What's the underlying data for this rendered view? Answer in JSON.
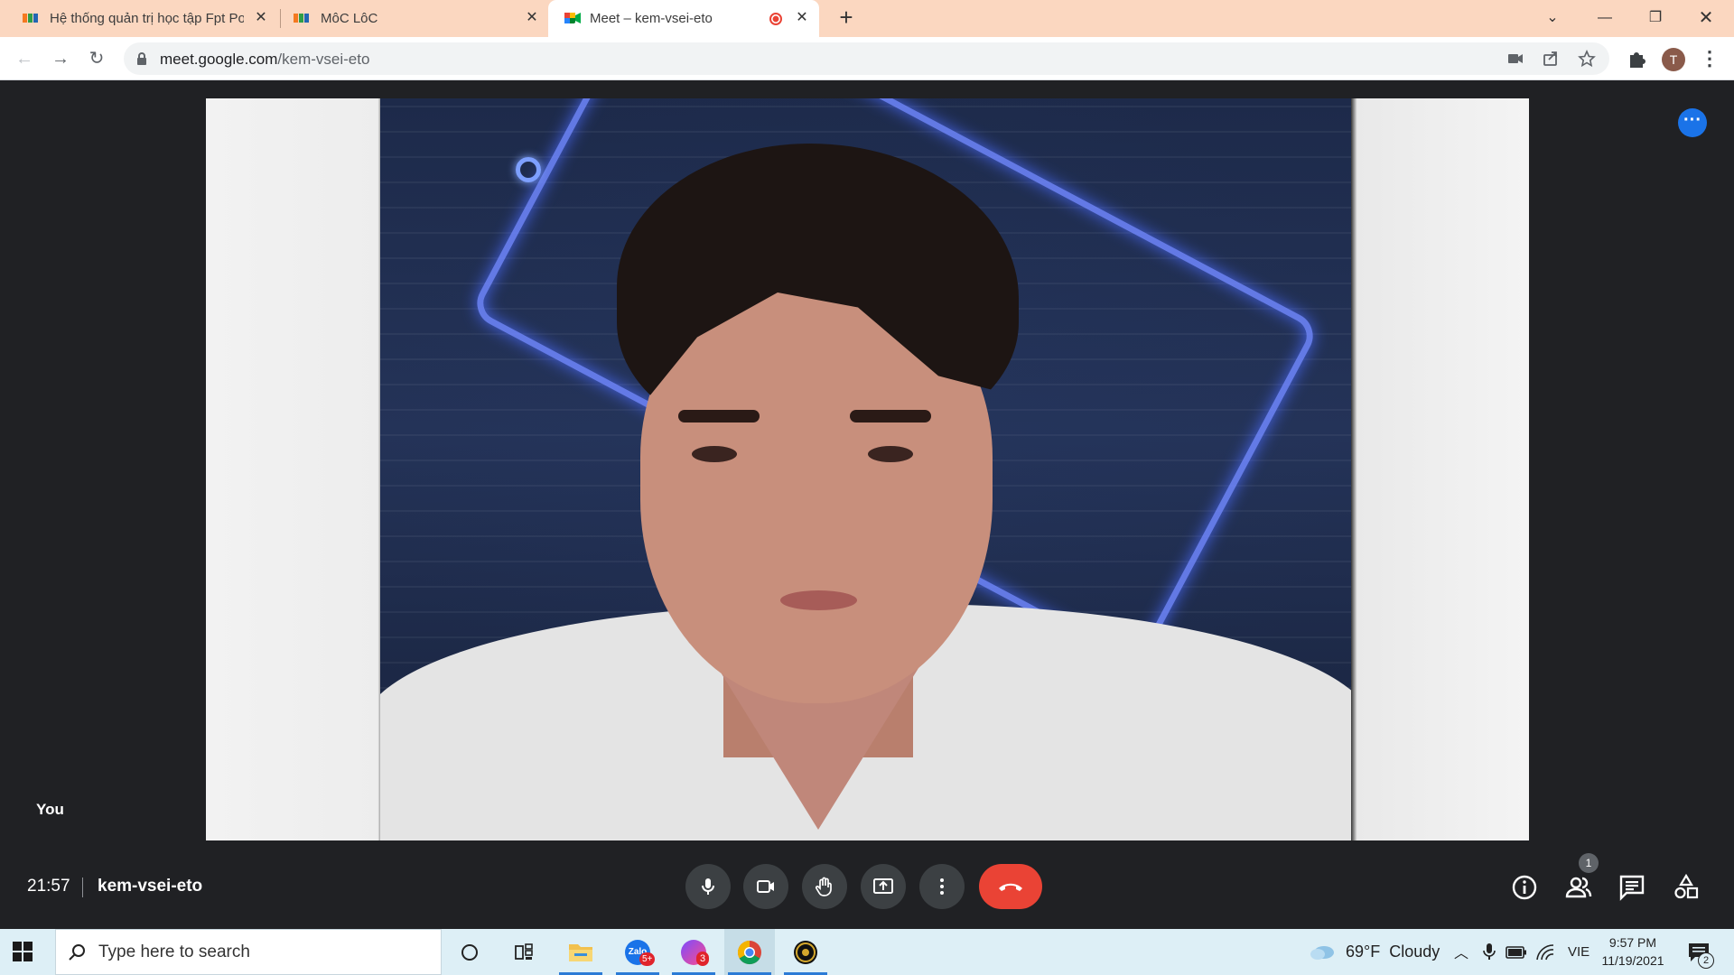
{
  "browser": {
    "tabs": [
      {
        "title": "Hệ thống quản trị học tập Fpt Po",
        "active": false
      },
      {
        "title": "MôC LôC",
        "active": false
      },
      {
        "title": "Meet – kem-vsei-eto",
        "active": true
      }
    ],
    "url_host": "meet.google.com",
    "url_path": "/kem-vsei-eto",
    "profile_initial": "T"
  },
  "meet": {
    "self_label": "You",
    "time": "21:57",
    "meeting_code": "kem-vsei-eto",
    "participants_count": "1",
    "end_call_color": "#ea4335",
    "accent_color": "#1a73e8"
  },
  "taskbar": {
    "search_placeholder": "Type here to search",
    "weather": "69°F  Cloudy",
    "language": "VIE",
    "time": "9:57 PM",
    "date": "11/19/2021",
    "notifications": "2",
    "zalo_badge": "5+",
    "messenger_badge": "3"
  }
}
